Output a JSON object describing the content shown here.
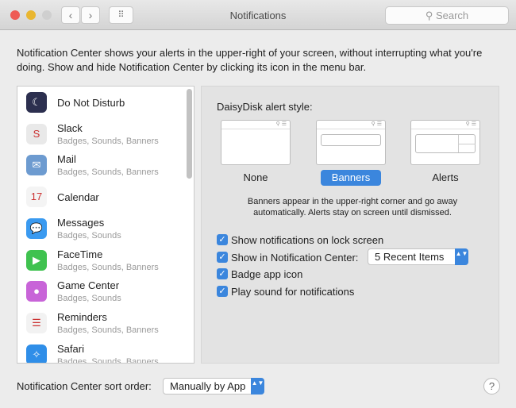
{
  "window": {
    "title": "Notifications",
    "search_placeholder": "Search",
    "back": "‹",
    "forward": "›",
    "grid": "⠿"
  },
  "intro": "Notification Center shows your alerts in the upper-right of your screen, without interrupting what you're doing. Show and hide Notification Center by clicking its icon in the menu bar.",
  "apps": [
    {
      "name": "Do Not Disturb",
      "sub": "",
      "color": "#2c2f4f",
      "glyph": "☾"
    },
    {
      "name": "Slack",
      "sub": "Badges, Sounds, Banners",
      "color": "#e9e9e9",
      "glyph": "S"
    },
    {
      "name": "Mail",
      "sub": "Badges, Sounds, Banners",
      "color": "#6d9bd0",
      "glyph": "✉"
    },
    {
      "name": "Calendar",
      "sub": "",
      "color": "#f4f4f4",
      "glyph": "17"
    },
    {
      "name": "Messages",
      "sub": "Badges, Sounds",
      "color": "#3a9af0",
      "glyph": "💬"
    },
    {
      "name": "FaceTime",
      "sub": "Badges, Sounds, Banners",
      "color": "#3fc24f",
      "glyph": "▶"
    },
    {
      "name": "Game Center",
      "sub": "Badges, Sounds",
      "color": "#c864d8",
      "glyph": "●"
    },
    {
      "name": "Reminders",
      "sub": "Badges, Sounds, Banners",
      "color": "#f2f2f2",
      "glyph": "☰"
    },
    {
      "name": "Safari",
      "sub": "Badges, Sounds, Banners",
      "color": "#2f8ee8",
      "glyph": "✧"
    }
  ],
  "panel": {
    "heading": "DaisyDisk alert style:",
    "styles": [
      "None",
      "Banners",
      "Alerts"
    ],
    "selected_style": "Banners",
    "thumb_icons": "⚲ ☰",
    "description": "Banners appear in the upper-right corner and go away automatically. Alerts stay on screen until dismissed.",
    "options": [
      {
        "label": "Show notifications on lock screen",
        "checked": true
      },
      {
        "label": "Show in Notification Center:",
        "checked": true
      },
      {
        "label": "Badge app icon",
        "checked": true
      },
      {
        "label": "Play sound for notifications",
        "checked": true
      }
    ],
    "recent_items": "5 Recent Items"
  },
  "footer": {
    "sort_label": "Notification Center sort order:",
    "sort_value": "Manually by App",
    "help": "?"
  },
  "check": "✓",
  "arrows": "▲▼"
}
